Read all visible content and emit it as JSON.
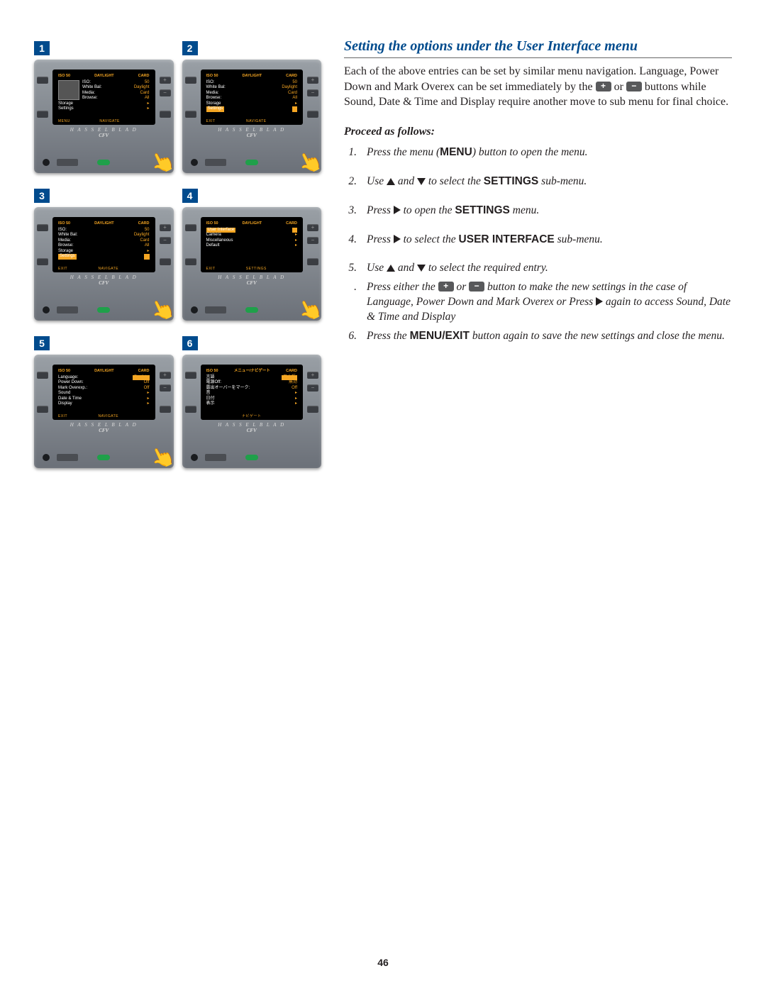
{
  "page_number": "46",
  "heading": "Setting the options under the User Interface menu",
  "intro_parts": {
    "p1": "Each of the above entries can be set by similar menu navigation. Language, Power Down and Mark Overex can be set immediately by the ",
    "p2": " or ",
    "p3": " buttons while Sound, Date & Time and Display require another move to sub menu for final choice."
  },
  "sub_heading": "Proceed as follows:",
  "steps": [
    {
      "num": "1.",
      "pre": "Press the menu (",
      "bold": "MENU",
      "post": ") button to open the menu."
    },
    {
      "num": "2.",
      "pre": "Use ",
      "mid": " and ",
      "post": " to select the ",
      "bold": "SETTINGS",
      "tail": " sub-menu."
    },
    {
      "num": "3.",
      "pre": "Press ",
      "post": " to open the ",
      "bold": "SETTINGS",
      "tail": " menu."
    },
    {
      "num": "4.",
      "pre": "Press ",
      "post": " to select the ",
      "bold": "USER INTERFACE",
      "tail": " sub-menu."
    },
    {
      "num": "5.",
      "pre": "Use ",
      "mid": " and ",
      "post": " to select the required entry."
    },
    {
      "num": ".",
      "pre": "Press either the ",
      "mid": " or ",
      "post": " button to make the new settings in the case of Language, Power Down and Mark Overex or Press ",
      "tail": " again to access Sound, Date & Time and Display"
    },
    {
      "num": "6.",
      "pre": "Press the ",
      "bold": "MENU/EXIT",
      "post": " button again to save the new settings and close the menu."
    }
  ],
  "figures": {
    "1": {
      "topbar": [
        "ISO 50",
        "DAYLIGHT",
        "CARD"
      ],
      "rows": [
        [
          "ISO:",
          "50"
        ],
        [
          "White Bal:",
          "Daylight"
        ],
        [
          "Media:",
          "Card"
        ],
        [
          "Browse:",
          "All"
        ],
        [
          "Storage",
          "▸"
        ],
        [
          "Settings",
          "▸"
        ]
      ],
      "bottom": [
        "MENU",
        "NAVIGATE",
        ""
      ],
      "thumb": true,
      "hand": true
    },
    "2": {
      "topbar": [
        "ISO 50",
        "DAYLIGHT",
        "CARD"
      ],
      "rows": [
        [
          "ISO:",
          "50"
        ],
        [
          "White Bal:",
          "Daylight"
        ],
        [
          "Media:",
          "Card"
        ],
        [
          "Browse:",
          "All"
        ],
        [
          "Storage",
          "▸"
        ],
        [
          "Settings",
          "▸"
        ]
      ],
      "highlight_row": 5,
      "bottom": [
        "EXIT",
        "NAVIGATE",
        ""
      ],
      "hand": true
    },
    "3": {
      "topbar": [
        "ISO 50",
        "DAYLIGHT",
        "CARD"
      ],
      "rows": [
        [
          "ISO:",
          "50"
        ],
        [
          "White Bal:",
          "Daylight"
        ],
        [
          "Media:",
          "Card"
        ],
        [
          "Browse:",
          "All"
        ],
        [
          "Storage",
          "▸"
        ],
        [
          "Settings",
          "▸"
        ]
      ],
      "highlight_row": 5,
      "bottom": [
        "EXIT",
        "NAVIGATE",
        ""
      ],
      "hand": true
    },
    "4": {
      "topbar": [
        "ISO 50",
        "DAYLIGHT",
        "CARD"
      ],
      "rows": [
        [
          "User Interface",
          "▸"
        ],
        [
          "Camera",
          "▸"
        ],
        [
          "Miscellaneous",
          "▸"
        ],
        [
          "Default",
          "▸"
        ]
      ],
      "highlight_row": 0,
      "bottom": [
        "EXIT",
        "SETTINGS",
        ""
      ],
      "hand": true
    },
    "5": {
      "topbar": [
        "ISO 50",
        "DAYLIGHT",
        "CARD"
      ],
      "rows": [
        [
          "Language:",
          "English"
        ],
        [
          "Power Down:",
          "Off"
        ],
        [
          "Mark Overexp.:",
          "Off"
        ],
        [
          "Sound",
          "▸"
        ],
        [
          "Date & Time",
          "▸"
        ],
        [
          "Display",
          "▸"
        ]
      ],
      "highlight_row": 0,
      "highlight_value": true,
      "bottom": [
        "EXIT",
        "NAVIGATE",
        ""
      ],
      "hand": true
    },
    "6": {
      "topbar": [
        "ISO 50",
        "メニュー/ナビゲート",
        "CARD"
      ],
      "rows": [
        [
          "言語",
          "日本語"
        ],
        [
          "電源Off:",
          "無効"
        ],
        [
          "露出オーバーをマーク:",
          "Off"
        ],
        [
          "音",
          "▸"
        ],
        [
          "日付",
          "▸"
        ],
        [
          "表示",
          "▸"
        ]
      ],
      "highlight_row": 0,
      "highlight_value": true,
      "bottom": [
        "",
        "ナビゲート",
        ""
      ],
      "hand": false
    }
  },
  "brand": "H A S S E L B L A D",
  "model": "CFV"
}
